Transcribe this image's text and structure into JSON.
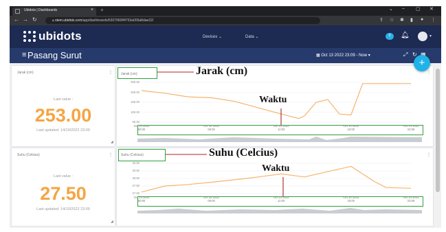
{
  "browser": {
    "tab_title": "Ubidots | Dashboards",
    "close_tab": "×",
    "new_tab": "+",
    "url_domain": "stem.ubidots.com",
    "url_path": "/app/dashboards/6307960f4f753a000a8dae32/"
  },
  "app": {
    "logo": "ubidots",
    "menu_devices": "Devices ⌄",
    "menu_data": "Data ⌄",
    "notifications_count": "2",
    "dashboard_title": "Pasang Surut",
    "date_range": "Oct 13 2022 23:09 - Now ▾"
  },
  "widgets": {
    "jarak_metric": {
      "title": "Jarak (cm)",
      "last_value_label": "Last value :",
      "value": "253.00",
      "last_updated": "Last updated: 14/10/2022 23:09"
    },
    "suhu_metric": {
      "title": "Suhu (Celsius)",
      "last_value_label": "Last value :",
      "value": "27.50",
      "last_updated": "Last updated: 14/10/2022 23:09"
    }
  },
  "charts": {
    "jarak": {
      "title": "Jarak (cm)",
      "yticks": [
        "250.00",
        "200.00",
        "150.00",
        "100.00",
        "50.00"
      ],
      "xticks": [
        {
          "l1": "Oct 14 2022",
          "l2": "00:00"
        },
        {
          "l1": "Oct 14 2022",
          "l2": "06:00"
        },
        {
          "l1": "Oct 14 2022",
          "l2": "12:00"
        },
        {
          "l1": "Oct 14 2022",
          "l2": "18:00"
        },
        {
          "l1": "Oct 14 2022",
          "l2": "23:09"
        }
      ]
    },
    "suhu": {
      "title": "Suhu (Celsius)",
      "yticks": [
        "30.50",
        "29.50",
        "28.50",
        "27.50",
        "27.00"
      ],
      "xticks": [
        {
          "l1": "Oct 14 2022",
          "l2": "00:00"
        },
        {
          "l1": "Oct 14 2022",
          "l2": "06:00"
        },
        {
          "l1": "Oct 14 2022",
          "l2": "12:00"
        },
        {
          "l1": "Oct 14 2022",
          "l2": "18:00"
        },
        {
          "l1": "Oct 14 2022",
          "l2": "23:09"
        }
      ]
    }
  },
  "annotations": {
    "jarak_label": "Jarak (cm)",
    "suhu_label": "Suhu (Celcius)",
    "waktu_label_1": "Waktu",
    "waktu_label_2": "Waktu"
  },
  "colors": {
    "header": "#1d2a52",
    "subheader": "#263a6c",
    "accent": "#20b3e8",
    "metric_value": "#f5a542",
    "series_line": "#f7b36b",
    "annotation_box": "#2f9e3a",
    "annotation_line": "#b02020"
  },
  "chart_data": [
    {
      "type": "line",
      "title": "Jarak (cm)",
      "xlabel": "",
      "ylabel": "",
      "ylim": [
        40,
        260
      ],
      "x": [
        "2022-10-14 00:00",
        "2022-10-14 02:00",
        "2022-10-14 04:00",
        "2022-10-14 06:00",
        "2022-10-14 08:00",
        "2022-10-14 10:00",
        "2022-10-14 12:00",
        "2022-10-14 13:30",
        "2022-10-14 14:00",
        "2022-10-14 15:00",
        "2022-10-14 16:00",
        "2022-10-14 17:00",
        "2022-10-14 18:00",
        "2022-10-14 19:00",
        "2022-10-14 23:09"
      ],
      "series": [
        {
          "values": [
            215,
            200,
            180,
            175,
            155,
            120,
            85,
            60,
            75,
            150,
            165,
            85,
            80,
            253,
            253
          ]
        }
      ]
    },
    {
      "type": "line",
      "title": "Suhu (Celsius)",
      "xlabel": "",
      "ylabel": "",
      "ylim": [
        26.8,
        30.8
      ],
      "x": [
        "2022-10-14 00:00",
        "2022-10-14 02:00",
        "2022-10-14 04:00",
        "2022-10-14 06:00",
        "2022-10-14 09:00",
        "2022-10-14 12:00",
        "2022-10-14 14:00",
        "2022-10-14 16:00",
        "2022-10-14 18:00",
        "2022-10-14 20:00",
        "2022-10-14 21:00",
        "2022-10-14 23:09"
      ],
      "series": [
        {
          "values": [
            27.0,
            27.8,
            28.0,
            28.3,
            28.8,
            29.4,
            29.0,
            29.7,
            30.4,
            28.4,
            27.6,
            27.5
          ]
        }
      ]
    }
  ]
}
